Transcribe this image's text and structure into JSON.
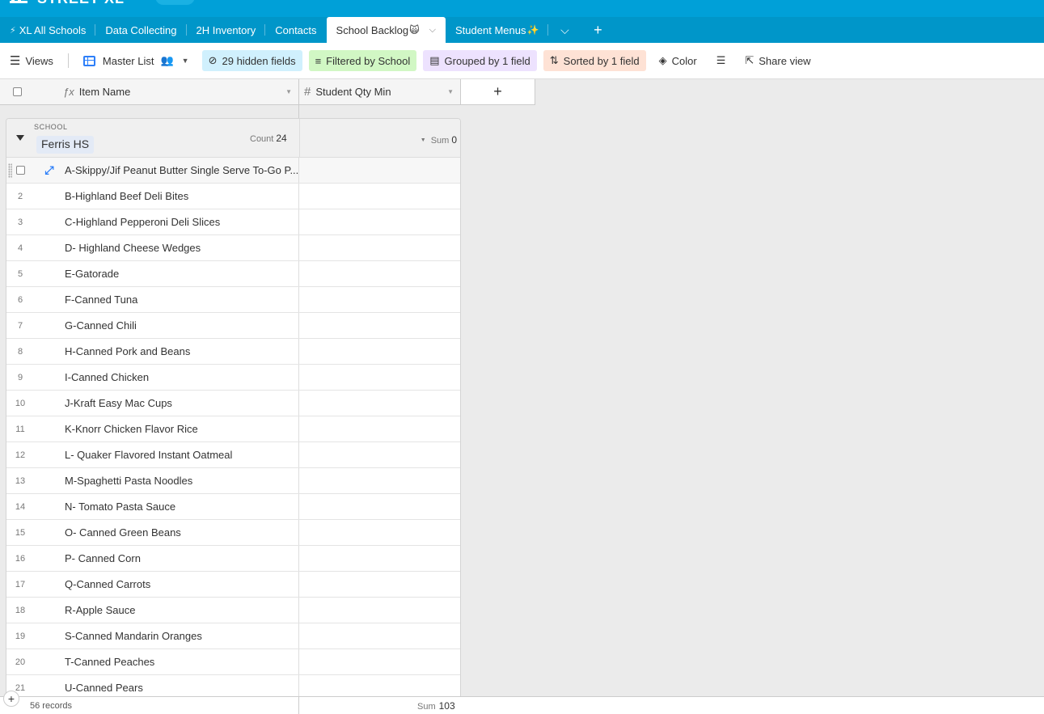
{
  "app": {
    "base_name": "STREET XL"
  },
  "tabs": [
    {
      "label": "XL All Schools",
      "icon": "⚡"
    },
    {
      "label": "Data Collecting"
    },
    {
      "label": "2H Inventory"
    },
    {
      "label": "Contacts"
    },
    {
      "label": "School Backlog",
      "emoji": "🙀",
      "active": true
    },
    {
      "label": "Student Menus",
      "emoji": "✨"
    }
  ],
  "toolbar": {
    "views_label": "Views",
    "view_name": "Master List",
    "hidden_fields": "29 hidden fields",
    "filter": "Filtered by School",
    "group": "Grouped by 1 field",
    "sort": "Sorted by 1 field",
    "color": "Color",
    "share": "Share view"
  },
  "columns": {
    "item_name": "Item Name",
    "student_qty": "Student Qty Min"
  },
  "group": {
    "field_label": "SCHOOL",
    "value": "Ferris HS",
    "count_label": "Count",
    "count": "24",
    "sum_label": "Sum",
    "sum": "0"
  },
  "rows": [
    {
      "num": "",
      "name": "A-Skippy/Jif Peanut Butter Single Serve To-Go P..."
    },
    {
      "num": "2",
      "name": "B-Highland Beef Deli Bites"
    },
    {
      "num": "3",
      "name": "C-Highland Pepperoni Deli Slices"
    },
    {
      "num": "4",
      "name": "D- Highland Cheese Wedges"
    },
    {
      "num": "5",
      "name": "E-Gatorade"
    },
    {
      "num": "6",
      "name": "F-Canned Tuna"
    },
    {
      "num": "7",
      "name": "G-Canned Chili"
    },
    {
      "num": "8",
      "name": "H-Canned Pork and Beans"
    },
    {
      "num": "9",
      "name": "I-Canned Chicken"
    },
    {
      "num": "10",
      "name": "J-Kraft Easy Mac Cups"
    },
    {
      "num": "11",
      "name": "K-Knorr Chicken Flavor Rice"
    },
    {
      "num": "12",
      "name": "L- Quaker Flavored Instant Oatmeal"
    },
    {
      "num": "13",
      "name": "M-Spaghetti Pasta Noodles"
    },
    {
      "num": "14",
      "name": "N- Tomato Pasta Sauce"
    },
    {
      "num": "15",
      "name": "O- Canned Green Beans"
    },
    {
      "num": "16",
      "name": "P- Canned Corn"
    },
    {
      "num": "17",
      "name": "Q-Canned Carrots"
    },
    {
      "num": "18",
      "name": "R-Apple Sauce"
    },
    {
      "num": "19",
      "name": "S-Canned Mandarin Oranges"
    },
    {
      "num": "20",
      "name": "T-Canned Peaches"
    },
    {
      "num": "21",
      "name": "U-Canned Pears"
    }
  ],
  "footer": {
    "records": "56 records",
    "sum_label": "Sum",
    "sum": "103"
  }
}
